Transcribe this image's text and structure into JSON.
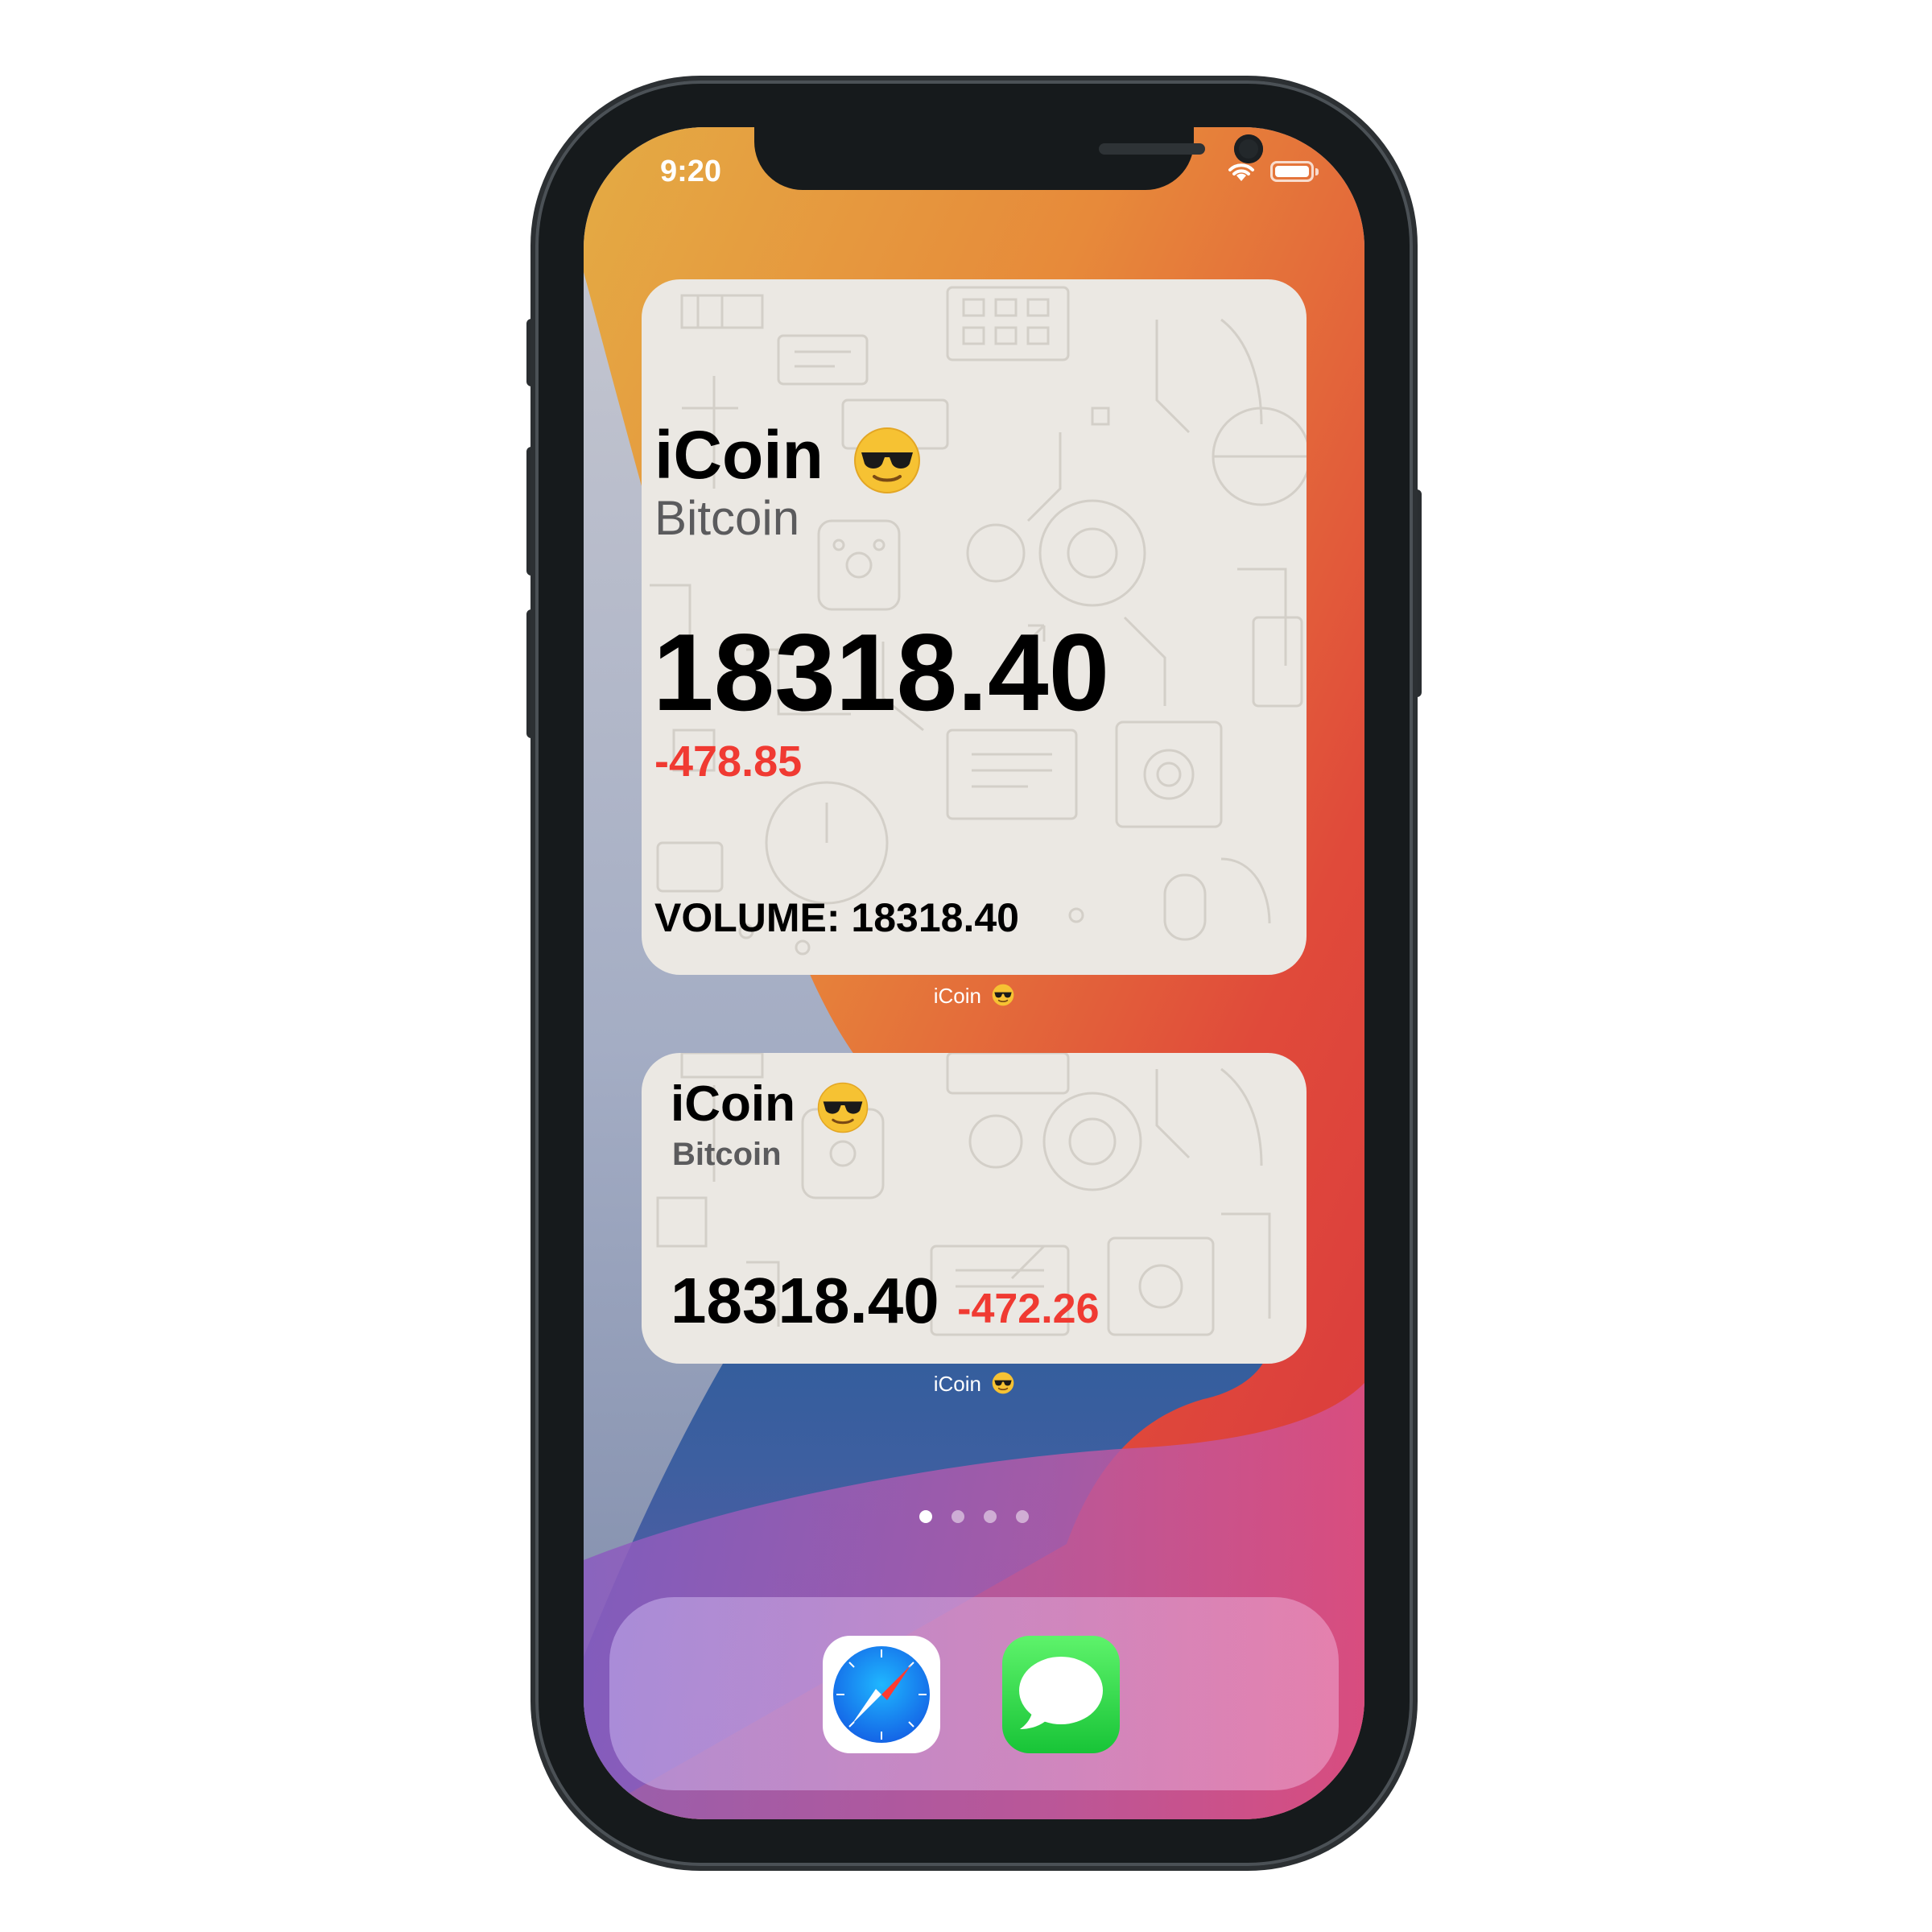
{
  "status_bar": {
    "time": "9:20"
  },
  "widgets": {
    "large": {
      "title": "iCoin",
      "subtitle": "Bitcoin",
      "price": "18318.40",
      "change": "-478.85",
      "volume": "VOLUME: 18318.40",
      "caption": "iCoin"
    },
    "medium": {
      "title": "iCoin",
      "subtitle": "Bitcoin",
      "price": "18318.40",
      "change": "-472.26",
      "caption": "iCoin"
    }
  },
  "page_indicator": {
    "count": 4,
    "active_index": 0
  },
  "dock": {
    "apps": [
      {
        "name": "Safari",
        "icon": "safari-compass-icon"
      },
      {
        "name": "Messages",
        "icon": "speech-bubble-icon"
      }
    ]
  },
  "colors": {
    "negative_change": "#f03a32",
    "widget_background": "#ebe8e3"
  }
}
